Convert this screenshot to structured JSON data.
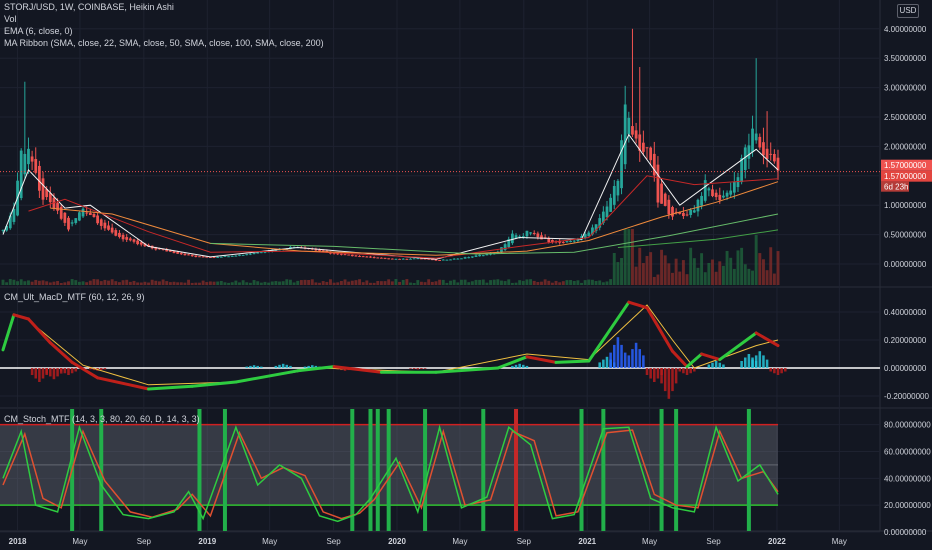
{
  "header": {
    "symbol_line": "STORJ/USD, 1W, COINBASE, Heikin Ashi",
    "vol_label": "Vol",
    "ema_label": "EMA (6, close, 0)",
    "ribbon_label": "MA Ribbon (SMA, close, 22, SMA, close, 50, SMA, close, 100, SMA, close, 200)",
    "currency_button": "USD"
  },
  "panes": {
    "macd_title": "CM_Ult_MacD_MTF (60, 12, 26, 9)",
    "stoch_title": "CM_Stoch_MTF (14, 3, 3, 80, 20, 60, D, 14, 3, 3)"
  },
  "price_tags": {
    "last_price": "1.57000000",
    "ema_price": "1.57000000",
    "countdown": "6d 23h"
  },
  "colors": {
    "background": "#131722",
    "bull": "#26a69a",
    "bear": "#ef5350",
    "grid": "#1e2230",
    "text": "#d1d4dc",
    "macd_up": "#2ecc40",
    "macd_down": "#c0201a",
    "signal": "#f0c040",
    "stoch_k": "#2ecc40",
    "stoch_d": "#e05030",
    "stoch_upper": "#d02020",
    "stoch_lower": "#30c030",
    "ribbon": [
      "#c62828",
      "#ef8a3c",
      "#66bb6a",
      "#43a047"
    ]
  },
  "chart_data": [
    {
      "type": "candlestick",
      "title": "STORJ/USD, 1W, COINBASE, Heikin Ashi",
      "x_ticks": [
        "2018",
        "May",
        "Sep",
        "2019",
        "May",
        "Sep",
        "2020",
        "May",
        "Sep",
        "2021",
        "May",
        "Sep",
        "2022",
        "May"
      ],
      "y_ticks": [
        "4.00000000",
        "3.50000000",
        "3.00000000",
        "2.50000000",
        "2.00000000",
        "1.50000000",
        "1.00000000",
        "0.50000000",
        "0.00000000"
      ],
      "ylim": [
        -0.18,
        4.1
      ],
      "last_value": 1.57,
      "close_path": [
        [
          "2017-12-04",
          0.55
        ],
        [
          "2017-12-25",
          0.95
        ],
        [
          "2018-01-08",
          1.9
        ],
        [
          "2018-01-22",
          2.0
        ],
        [
          "2018-02-12",
          1.2
        ],
        [
          "2018-03-12",
          0.95
        ],
        [
          "2018-04-09",
          0.6
        ],
        [
          "2018-05-07",
          0.95
        ],
        [
          "2018-05-28",
          0.8
        ],
        [
          "2018-06-25",
          0.55
        ],
        [
          "2018-08-06",
          0.38
        ],
        [
          "2018-09-10",
          0.28
        ],
        [
          "2018-10-15",
          0.22
        ],
        [
          "2018-12-10",
          0.12
        ],
        [
          "2019-01-14",
          0.12
        ],
        [
          "2019-03-11",
          0.16
        ],
        [
          "2019-05-06",
          0.24
        ],
        [
          "2019-06-24",
          0.3
        ],
        [
          "2019-08-05",
          0.22
        ],
        [
          "2019-09-09",
          0.16
        ],
        [
          "2019-11-04",
          0.12
        ],
        [
          "2019-12-23",
          0.08
        ],
        [
          "2020-02-10",
          0.1
        ],
        [
          "2020-03-16",
          0.06
        ],
        [
          "2020-05-04",
          0.1
        ],
        [
          "2020-07-13",
          0.2
        ],
        [
          "2020-08-10",
          0.5
        ],
        [
          "2020-08-24",
          0.45
        ],
        [
          "2020-09-07",
          0.55
        ],
        [
          "2020-10-05",
          0.42
        ],
        [
          "2020-11-16",
          0.35
        ],
        [
          "2020-12-21",
          0.45
        ],
        [
          "2021-01-11",
          0.62
        ],
        [
          "2021-02-08",
          0.95
        ],
        [
          "2021-02-22",
          1.3
        ],
        [
          "2021-03-01",
          1.5
        ],
        [
          "2021-03-08",
          2.05
        ],
        [
          "2021-03-15",
          2.6
        ],
        [
          "2021-03-29",
          2.2
        ],
        [
          "2021-04-12",
          2.0
        ],
        [
          "2021-05-03",
          1.8
        ],
        [
          "2021-05-17",
          1.05
        ],
        [
          "2021-06-14",
          0.85
        ],
        [
          "2021-07-05",
          0.82
        ],
        [
          "2021-07-26",
          0.95
        ],
        [
          "2021-08-16",
          1.35
        ],
        [
          "2021-09-06",
          1.1
        ],
        [
          "2021-09-27",
          1.2
        ],
        [
          "2021-10-18",
          1.5
        ],
        [
          "2021-11-01",
          1.95
        ],
        [
          "2021-11-15",
          2.2
        ],
        [
          "2021-12-06",
          1.9
        ],
        [
          "2021-12-20",
          1.8
        ],
        [
          "2022-01-03",
          1.57
        ]
      ],
      "spike_highs": [
        [
          "2018-01-15",
          3.1
        ],
        [
          "2021-03-29",
          4.0
        ],
        [
          "2021-04-12",
          3.35
        ],
        [
          "2021-11-22",
          3.5
        ],
        [
          "2021-12-13",
          2.6
        ]
      ],
      "moving_averages": {
        "ema_6": [
          [
            "2017-12-04",
            0.5
          ],
          [
            "2018-01-22",
            1.6
          ],
          [
            "2018-04-02",
            0.95
          ],
          [
            "2018-05-21",
            1.0
          ],
          [
            "2018-09-10",
            0.3
          ],
          [
            "2019-01-07",
            0.12
          ],
          [
            "2019-06-24",
            0.28
          ],
          [
            "2020-03-16",
            0.08
          ],
          [
            "2020-08-24",
            0.45
          ],
          [
            "2020-12-21",
            0.42
          ],
          [
            "2021-03-22",
            2.2
          ],
          [
            "2021-06-28",
            1.0
          ],
          [
            "2021-11-22",
            1.95
          ],
          [
            "2022-01-03",
            1.6
          ]
        ],
        "sma_22": [
          [
            "2018-01-22",
            0.9
          ],
          [
            "2018-04-02",
            1.1
          ],
          [
            "2018-09-10",
            0.55
          ],
          [
            "2019-01-07",
            0.2
          ],
          [
            "2019-07-01",
            0.22
          ],
          [
            "2020-03-16",
            0.1
          ],
          [
            "2020-08-24",
            0.3
          ],
          [
            "2021-01-04",
            0.45
          ],
          [
            "2021-04-26",
            1.5
          ],
          [
            "2021-07-26",
            1.35
          ],
          [
            "2022-01-03",
            1.45
          ]
        ],
        "sma_50": [
          [
            "2018-03-05",
            0.95
          ],
          [
            "2018-07-02",
            0.85
          ],
          [
            "2019-01-07",
            0.35
          ],
          [
            "2019-07-01",
            0.22
          ],
          [
            "2020-03-16",
            0.15
          ],
          [
            "2020-09-07",
            0.22
          ],
          [
            "2021-01-04",
            0.4
          ],
          [
            "2021-05-24",
            0.8
          ],
          [
            "2021-09-06",
            1.05
          ],
          [
            "2022-01-03",
            1.4
          ]
        ],
        "sma_100": [
          [
            "2019-01-07",
            0.35
          ],
          [
            "2019-09-02",
            0.3
          ],
          [
            "2020-06-01",
            0.17
          ],
          [
            "2020-12-07",
            0.2
          ],
          [
            "2021-06-07",
            0.48
          ],
          [
            "2022-01-03",
            0.85
          ]
        ],
        "sma_200": [
          [
            "2021-03-01",
            0.28
          ],
          [
            "2021-09-06",
            0.42
          ],
          [
            "2022-01-03",
            0.58
          ]
        ]
      }
    },
    {
      "type": "line",
      "title": "CM_Ult_MacD_MTF (60, 12, 26, 9)",
      "y_ticks": [
        "0.40000000",
        "0.20000000",
        "0.00000000",
        "-0.20000000"
      ],
      "ylim": [
        -0.3,
        0.5
      ],
      "series": [
        {
          "values": [
            [
              "2017-12-04",
              0.13
            ],
            [
              "2017-12-25",
              0.38
            ],
            [
              "2018-01-22",
              0.35
            ],
            [
              "2018-03-05",
              0.18
            ],
            [
              "2018-04-16",
              0.04
            ],
            [
              "2018-06-04",
              -0.07
            ],
            [
              "2018-09-10",
              -0.15
            ],
            [
              "2018-12-03",
              -0.13
            ],
            [
              "2019-02-25",
              -0.1
            ],
            [
              "2019-06-24",
              -0.02
            ],
            [
              "2019-09-02",
              0.01
            ],
            [
              "2019-12-02",
              -0.03
            ],
            [
              "2020-03-16",
              -0.03
            ],
            [
              "2020-07-13",
              0.0
            ],
            [
              "2020-09-07",
              0.08
            ],
            [
              "2020-11-02",
              0.04
            ],
            [
              "2021-01-04",
              0.05
            ],
            [
              "2021-03-22",
              0.47
            ],
            [
              "2021-04-26",
              0.43
            ],
            [
              "2021-06-14",
              0.12
            ],
            [
              "2021-07-12",
              0.01
            ],
            [
              "2021-08-09",
              0.1
            ],
            [
              "2021-09-13",
              0.06
            ],
            [
              "2021-11-22",
              0.25
            ],
            [
              "2022-01-03",
              0.16
            ]
          ]
        },
        {
          "values": [
            [
              "2018-01-22",
              0.34
            ],
            [
              "2018-05-07",
              0.02
            ],
            [
              "2018-09-10",
              -0.12
            ],
            [
              "2019-02-25",
              -0.1
            ],
            [
              "2019-08-05",
              0.0
            ],
            [
              "2020-03-16",
              -0.03
            ],
            [
              "2020-09-07",
              0.1
            ],
            [
              "2021-01-04",
              0.06
            ],
            [
              "2021-04-26",
              0.45
            ],
            [
              "2021-06-14",
              0.2
            ],
            [
              "2021-07-26",
              0.0
            ],
            [
              "2021-11-22",
              0.16
            ],
            [
              "2022-01-03",
              0.2
            ]
          ]
        }
      ],
      "histogram": [
        [
          "2018-02-12",
          -0.1
        ],
        [
          "2018-03-12",
          -0.08
        ],
        [
          "2018-04-09",
          -0.05
        ],
        [
          "2018-06-04",
          -0.02
        ],
        [
          "2019-04-01",
          0.02
        ],
        [
          "2019-05-27",
          0.03
        ],
        [
          "2019-07-22",
          0.02
        ],
        [
          "2019-09-23",
          -0.02
        ],
        [
          "2020-02-10",
          -0.01
        ],
        [
          "2020-08-24",
          0.03
        ],
        [
          "2021-02-08",
          0.08
        ],
        [
          "2021-03-01",
          0.22
        ],
        [
          "2021-04-05",
          0.18
        ],
        [
          "2021-05-10",
          -0.1
        ],
        [
          "2021-06-07",
          -0.22
        ],
        [
          "2021-07-12",
          -0.05
        ],
        [
          "2021-09-06",
          0.05
        ],
        [
          "2021-11-08",
          0.1
        ],
        [
          "2021-11-29",
          0.12
        ],
        [
          "2022-01-03",
          -0.05
        ]
      ]
    },
    {
      "type": "line",
      "title": "CM_Stoch_MTF (14, 3, 3, 80, 20, 60, D, 14, 3, 3)",
      "y_ticks": [
        "80.00000000",
        "60.00000000",
        "40.00000000",
        "20.00000000",
        "0.00000000"
      ],
      "ylim": [
        -5,
        90
      ],
      "upper_band": 80,
      "lower_band": 20,
      "signals_buy": [
        "2018-04-16",
        "2018-06-11",
        "2018-12-17",
        "2019-02-04",
        "2019-10-07",
        "2019-11-11",
        "2019-11-25",
        "2019-12-16",
        "2020-02-24",
        "2020-06-15",
        "2020-12-21",
        "2021-02-01",
        "2021-05-24",
        "2021-06-21",
        "2021-11-08"
      ],
      "signals_sell": [
        "2020-08-17"
      ],
      "series": [
        {
          "values": [
            [
              "2017-12-04",
              40
            ],
            [
              "2018-01-08",
              75
            ],
            [
              "2018-02-05",
              20
            ],
            [
              "2018-03-19",
              15
            ],
            [
              "2018-04-30",
              78
            ],
            [
              "2018-06-11",
              35
            ],
            [
              "2018-07-23",
              13
            ],
            [
              "2018-09-10",
              10
            ],
            [
              "2018-10-29",
              15
            ],
            [
              "2018-11-26",
              30
            ],
            [
              "2018-12-24",
              10
            ],
            [
              "2019-02-25",
              78
            ],
            [
              "2019-04-08",
              35
            ],
            [
              "2019-05-20",
              50
            ],
            [
              "2019-07-01",
              40
            ],
            [
              "2019-08-05",
              12
            ],
            [
              "2019-09-09",
              8
            ],
            [
              "2019-10-14",
              13
            ],
            [
              "2019-11-11",
              25
            ],
            [
              "2019-12-30",
              55
            ],
            [
              "2020-02-10",
              15
            ],
            [
              "2020-03-23",
              78
            ],
            [
              "2020-05-04",
              18
            ],
            [
              "2020-06-22",
              26
            ],
            [
              "2020-08-03",
              78
            ],
            [
              "2020-09-14",
              65
            ],
            [
              "2020-10-26",
              10
            ],
            [
              "2020-12-07",
              13
            ],
            [
              "2021-02-01",
              77
            ],
            [
              "2021-03-22",
              78
            ],
            [
              "2021-05-03",
              25
            ],
            [
              "2021-06-14",
              18
            ],
            [
              "2021-07-26",
              15
            ],
            [
              "2021-09-06",
              78
            ],
            [
              "2021-10-18",
              38
            ],
            [
              "2021-11-29",
              50
            ],
            [
              "2022-01-03",
              28
            ]
          ]
        },
        {
          "values": [
            [
              "2017-12-04",
              35
            ],
            [
              "2018-01-15",
              73
            ],
            [
              "2018-02-19",
              25
            ],
            [
              "2018-03-26",
              18
            ],
            [
              "2018-05-07",
              75
            ],
            [
              "2018-06-18",
              38
            ],
            [
              "2018-08-06",
              15
            ],
            [
              "2018-09-17",
              11
            ],
            [
              "2018-11-05",
              17
            ],
            [
              "2018-12-03",
              28
            ],
            [
              "2019-01-07",
              12
            ],
            [
              "2019-03-04",
              74
            ],
            [
              "2019-04-15",
              40
            ],
            [
              "2019-05-27",
              48
            ],
            [
              "2019-07-08",
              42
            ],
            [
              "2019-08-12",
              15
            ],
            [
              "2019-09-16",
              10
            ],
            [
              "2019-10-21",
              14
            ],
            [
              "2019-11-18",
              24
            ],
            [
              "2020-01-06",
              52
            ],
            [
              "2020-02-17",
              18
            ],
            [
              "2020-03-30",
              75
            ],
            [
              "2020-05-11",
              20
            ],
            [
              "2020-06-29",
              24
            ],
            [
              "2020-08-10",
              75
            ],
            [
              "2020-09-21",
              68
            ],
            [
              "2020-11-02",
              12
            ],
            [
              "2020-12-14",
              15
            ],
            [
              "2021-02-08",
              74
            ],
            [
              "2021-03-29",
              76
            ],
            [
              "2021-05-10",
              28
            ],
            [
              "2021-06-21",
              20
            ],
            [
              "2021-08-02",
              18
            ],
            [
              "2021-09-13",
              75
            ],
            [
              "2021-10-25",
              40
            ],
            [
              "2021-12-06",
              45
            ],
            [
              "2022-01-03",
              30
            ]
          ]
        }
      ]
    }
  ]
}
